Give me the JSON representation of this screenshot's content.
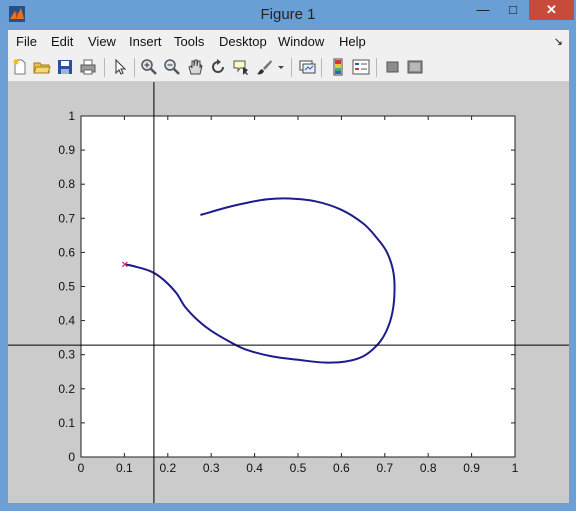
{
  "window": {
    "title": "Figure 1",
    "controls": {
      "minimize": "—",
      "maximize": "□",
      "close": "✕"
    }
  },
  "menu": {
    "items": [
      "File",
      "Edit",
      "View",
      "Insert",
      "Tools",
      "Desktop",
      "Window",
      "Help"
    ],
    "dock_glyph": "↘"
  },
  "toolbar": {
    "icons": [
      "new-figure-icon",
      "open-file-icon",
      "save-icon",
      "print-icon",
      "edit-plot-arrow-icon",
      "zoom-in-icon",
      "zoom-out-icon",
      "pan-hand-icon",
      "rotate-3d-icon",
      "data-cursor-icon",
      "brush-icon",
      "brush-dropdown-icon",
      "link-plot-icon",
      "colorbar-icon",
      "legend-icon",
      "hide-plot-tools-icon",
      "show-plot-tools-icon"
    ]
  },
  "colors": {
    "line": "#1c1c8c",
    "marker": "#cc3366",
    "axes_bg": "#ffffff",
    "figure_bg": "#cbcbcb"
  },
  "chart_data": {
    "type": "line",
    "title": "",
    "xlabel": "",
    "ylabel": "",
    "xlim": [
      0,
      1
    ],
    "ylim": [
      0,
      1
    ],
    "xticks": [
      "0",
      "0.1",
      "0.2",
      "0.3",
      "0.4",
      "0.5",
      "0.6",
      "0.7",
      "0.8",
      "0.9",
      "1"
    ],
    "yticks": [
      "0",
      "0.1",
      "0.2",
      "0.3",
      "0.4",
      "0.5",
      "0.6",
      "0.7",
      "0.8",
      "0.9",
      "1"
    ],
    "grid": false,
    "crosshair": {
      "x": 0.168,
      "y": 0.328
    },
    "start_marker": {
      "x": 0.101,
      "y": 0.565
    },
    "series": [
      {
        "x": [
          0.101,
          0.12,
          0.16,
          0.19,
          0.22,
          0.24,
          0.27,
          0.3,
          0.34,
          0.38,
          0.44,
          0.5,
          0.56,
          0.61,
          0.65,
          0.68,
          0.7,
          0.715,
          0.722,
          0.72,
          0.705,
          0.68,
          0.65,
          0.6,
          0.54,
          0.48,
          0.43,
          0.38,
          0.33,
          0.29,
          0.275
        ],
        "y": [
          0.565,
          0.56,
          0.545,
          0.52,
          0.48,
          0.44,
          0.4,
          0.37,
          0.34,
          0.315,
          0.295,
          0.285,
          0.277,
          0.28,
          0.295,
          0.325,
          0.36,
          0.41,
          0.47,
          0.54,
          0.6,
          0.645,
          0.685,
          0.725,
          0.75,
          0.758,
          0.756,
          0.745,
          0.73,
          0.715,
          0.71
        ]
      }
    ]
  }
}
